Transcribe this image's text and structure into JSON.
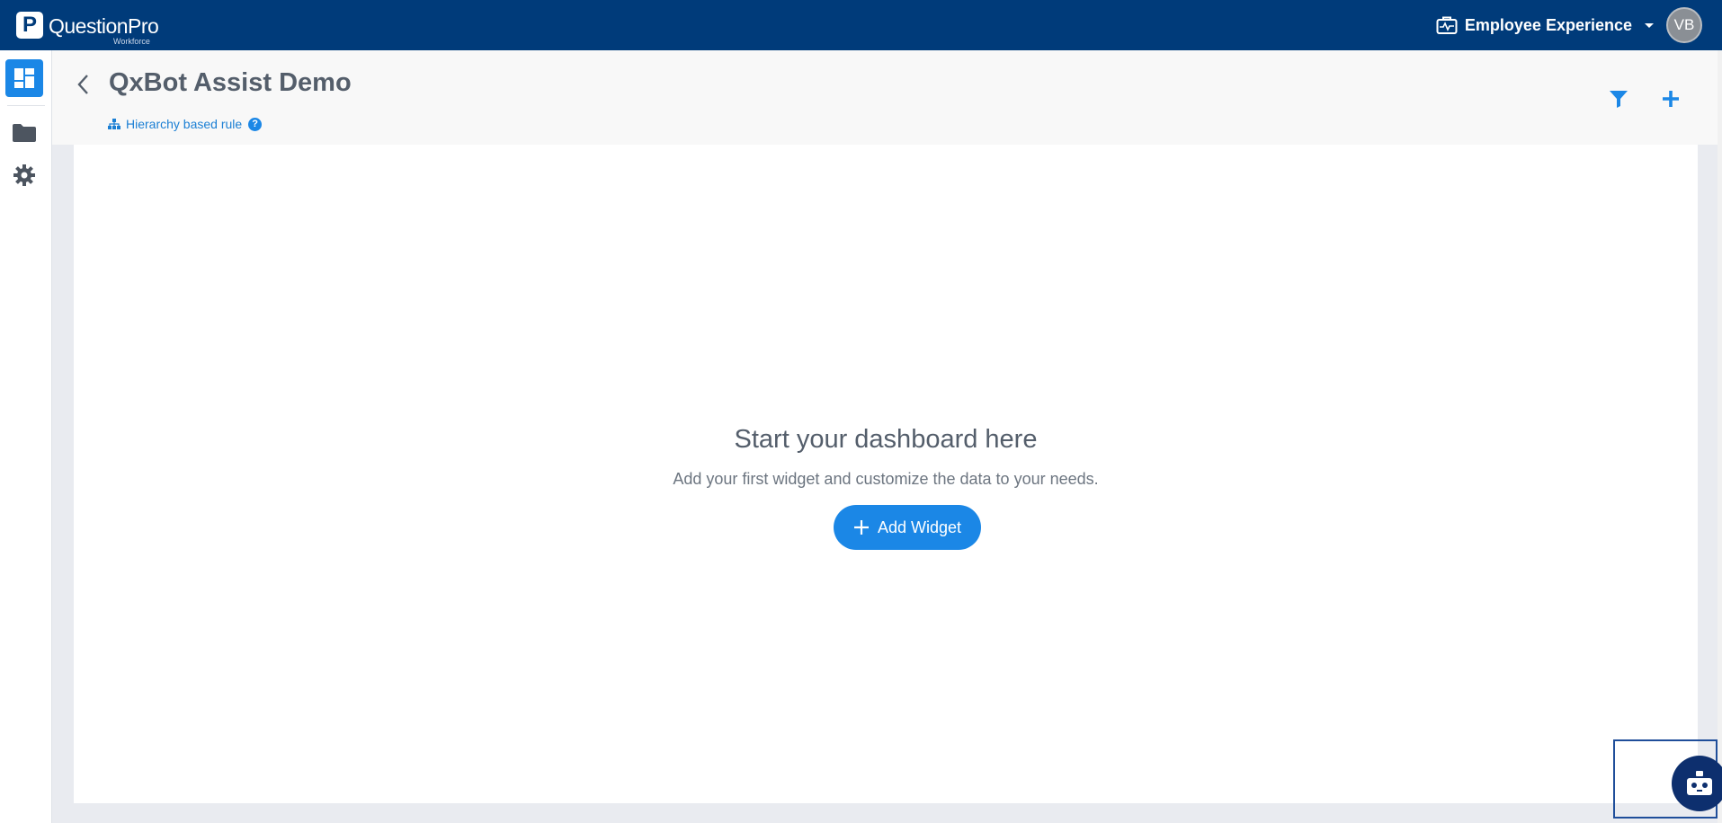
{
  "topbar": {
    "brand_name": "QuestionPro",
    "brand_sub": "Workforce",
    "brand_mark": "P",
    "workspace_label": "Employee Experience",
    "avatar_initials": "VB"
  },
  "sidebar": {
    "items": [
      {
        "name": "dashboard",
        "icon": "dashboard-icon",
        "active": true
      },
      {
        "name": "folder",
        "icon": "folder-icon",
        "active": false
      },
      {
        "name": "settings",
        "icon": "gear-icon",
        "active": false
      }
    ]
  },
  "header": {
    "title": "QxBot Assist Demo",
    "rule_label": "Hierarchy based rule",
    "help_glyph": "?"
  },
  "empty_state": {
    "title": "Start your dashboard here",
    "subtitle": "Add your first widget and customize the data to your needs.",
    "button_label": "Add Widget"
  },
  "colors": {
    "topbar": "#003b7a",
    "accent": "#1b87e6",
    "bot": "#0d2f6e",
    "canvas_bg": "#e9ebf0"
  }
}
